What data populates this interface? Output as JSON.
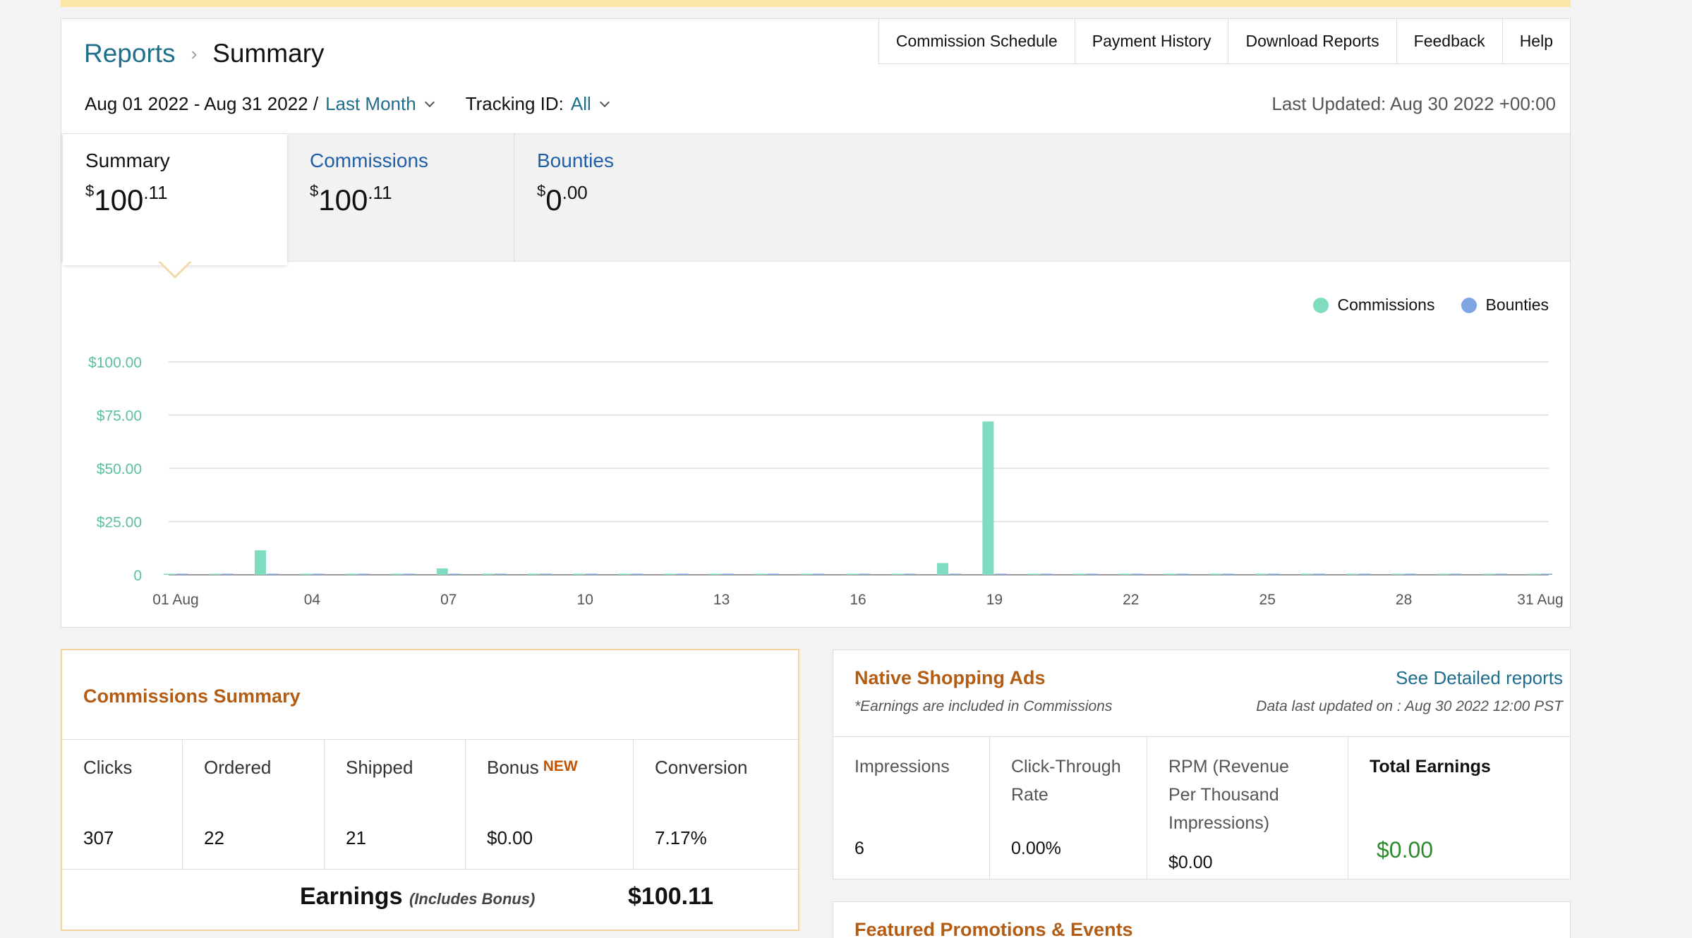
{
  "breadcrumb": {
    "parent": "Reports",
    "current": "Summary"
  },
  "nav": [
    "Commission Schedule",
    "Payment History",
    "Download Reports",
    "Feedback",
    "Help"
  ],
  "filters": {
    "date_range": "Aug 01 2022 - Aug 31 2022 /",
    "period": "Last Month",
    "tracking_label": "Tracking ID:",
    "tracking_value": "All"
  },
  "last_updated": "Last Updated: Aug 30 2022 +00:00",
  "summary_tabs": [
    {
      "title": "Summary",
      "dollars": "100",
      "cents": ".11"
    },
    {
      "title": "Commissions",
      "dollars": "100",
      "cents": ".11"
    },
    {
      "title": "Bounties",
      "dollars": "0",
      "cents": ".00"
    }
  ],
  "colors": {
    "commissions": "#7fdcc0",
    "bounties": "#7ea5e3",
    "accent_orange": "#b35c14",
    "link": "#1f6e8c"
  },
  "chart_data": {
    "type": "bar",
    "categories": [
      "01 Aug",
      "02",
      "03",
      "04",
      "05",
      "06",
      "07",
      "08",
      "09",
      "10",
      "11",
      "12",
      "13",
      "14",
      "15",
      "16",
      "17",
      "18",
      "19",
      "20",
      "21",
      "22",
      "23",
      "24",
      "25",
      "26",
      "27",
      "28",
      "29",
      "30",
      "31 Aug"
    ],
    "x_tick_labels": [
      "01 Aug",
      "04",
      "07",
      "10",
      "13",
      "16",
      "19",
      "22",
      "25",
      "28",
      "31 Aug"
    ],
    "series": [
      {
        "name": "Commissions",
        "values": [
          0.5,
          0.5,
          11.5,
          0.5,
          0.5,
          0.5,
          3.0,
          0.5,
          0.5,
          0.5,
          0.5,
          0.5,
          0.5,
          0.5,
          0.5,
          0.5,
          0.5,
          5.5,
          72.0,
          0.5,
          0.5,
          0.5,
          0.5,
          0.5,
          0.5,
          0.5,
          0.5,
          0.5,
          0.5,
          0.5,
          0.5
        ]
      },
      {
        "name": "Bounties",
        "values": [
          0.5,
          0.5,
          0.5,
          0.5,
          0.5,
          0.5,
          0.5,
          0.5,
          0.5,
          0.5,
          0.5,
          0.5,
          0.5,
          0.5,
          0.5,
          0.5,
          0.5,
          0.5,
          0.5,
          0.5,
          0.5,
          0.5,
          0.5,
          0.5,
          0.5,
          0.5,
          0.5,
          0.5,
          0.5,
          0.5,
          0.5
        ]
      }
    ],
    "y_ticks": [
      0,
      25,
      50,
      75,
      100
    ],
    "y_tick_labels": [
      "0",
      "$25.00",
      "$50.00",
      "$75.00",
      "$100.00"
    ],
    "ylim": [
      0,
      100
    ],
    "grid": true,
    "legend": "top-right"
  },
  "commissions_summary": {
    "title": "Commissions Summary",
    "columns": [
      {
        "label": "Clicks",
        "value": "307"
      },
      {
        "label": "Ordered",
        "value": "22"
      },
      {
        "label": "Shipped",
        "value": "21"
      },
      {
        "label": "Bonus",
        "badge": "NEW",
        "value": "$0.00"
      },
      {
        "label": "Conversion",
        "value": "7.17%"
      }
    ],
    "earnings_label": "Earnings",
    "earnings_note": "(Includes Bonus)",
    "earnings_value": "$100.11"
  },
  "native_ads": {
    "title": "Native Shopping Ads",
    "note": "*Earnings are included in Commissions",
    "link": "See Detailed reports",
    "updated": "Data last updated on : Aug 30 2022 12:00 PST",
    "columns": [
      {
        "label_line1": "Impressions",
        "value": "6"
      },
      {
        "label_line1": "Click-Through",
        "label_line2": "Rate",
        "value": "0.00%"
      },
      {
        "label_line1": "RPM (Revenue",
        "label_line2": "Per Thousand",
        "label_line3": "Impressions)",
        "value": "$0.00"
      },
      {
        "label_line1": "Total Earnings",
        "value": "$0.00"
      }
    ]
  },
  "featured": {
    "title": "Featured Promotions & Events"
  }
}
